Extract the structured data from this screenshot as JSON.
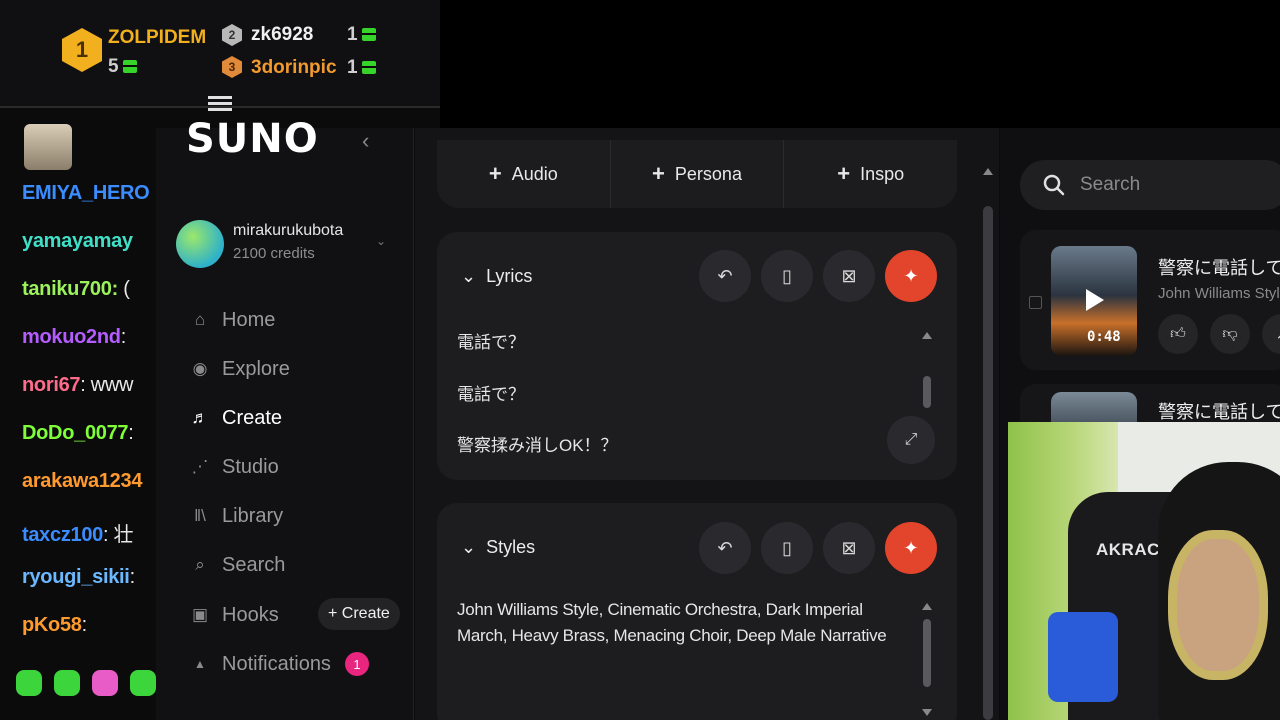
{
  "leaderboard": {
    "first": {
      "rank": "1",
      "name": "ZOLPIDEM",
      "count": "5",
      "color": "#f2b01e"
    },
    "second": {
      "rank": "2",
      "name": "zk6928",
      "count": "1",
      "color": "#b8b8b8"
    },
    "third": {
      "rank": "3",
      "name": "3dorinpic",
      "count": "1",
      "color": "#f29a2e"
    }
  },
  "chat": [
    {
      "user": "EMIYA_HERO",
      "color": "#3a8cff",
      "msg": ""
    },
    {
      "user": "yamayamay",
      "color": "#3fe0c8",
      "msg": ""
    },
    {
      "user": "taniku700:",
      "color": "#9cf25c",
      "msg": " ("
    },
    {
      "user": "mokuo2nd",
      "color": "#b45cff",
      "msg": ": "
    },
    {
      "user": "nori67",
      "color": "#ff6b8a",
      "msg": ": www"
    },
    {
      "user": "DoDo_0077",
      "color": "#7fff3a",
      "msg": ":"
    },
    {
      "user": "arakawa1234",
      "color": "#ff9a2e",
      "msg": ""
    },
    {
      "user": "taxcz100",
      "color": "#3a8cff",
      "msg": ": 壮"
    },
    {
      "user": "ryougi_sikii",
      "color": "#6bb8ff",
      "msg": ":"
    },
    {
      "user": "pKo58",
      "color": "#ff9a2e",
      "msg": ":"
    }
  ],
  "sidebar": {
    "logo": "SUNO",
    "username": "mirakurukubota",
    "credits": "2100 credits",
    "nav": [
      {
        "label": "Home",
        "icon": "⌂"
      },
      {
        "label": "Explore",
        "icon": "◉"
      },
      {
        "label": "Create",
        "icon": "♬"
      },
      {
        "label": "Studio",
        "icon": "⋰"
      },
      {
        "label": "Library",
        "icon": "ǁ\\"
      },
      {
        "label": "Search",
        "icon": "⌕"
      },
      {
        "label": "Hooks",
        "icon": "▣"
      },
      {
        "label": "Notifications",
        "icon": "▲"
      }
    ],
    "hooks_create": "+ Create",
    "notif_count": "1"
  },
  "addbar": {
    "audio": "Audio",
    "persona": "Persona",
    "inspo": "Inspo"
  },
  "lyrics": {
    "title": "Lyrics",
    "lines": [
      "電話で？",
      "電話で？",
      "警察揉み消しOK！？"
    ]
  },
  "styles": {
    "title": "Styles",
    "text": "John Williams Style, Cinematic Orchestra, Dark Imperial March, Heavy Brass, Menacing Choir, Deep Male Narrative"
  },
  "right": {
    "search_placeholder": "Search",
    "song1": {
      "title": "警察に電話して今",
      "style": "John Williams Style",
      "duration": "0:48"
    },
    "song2": {
      "title": "警察に電話して今"
    }
  },
  "webcam": {
    "chair_text": "AKRACI"
  }
}
